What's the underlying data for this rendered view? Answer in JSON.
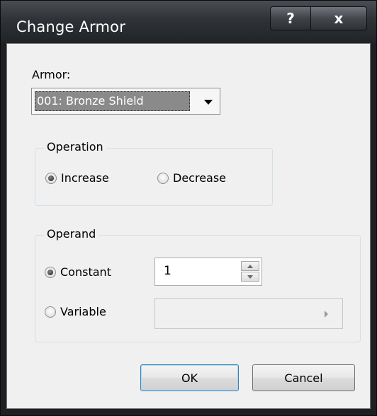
{
  "window": {
    "title": "Change Armor",
    "help_glyph": "?",
    "close_glyph": "x"
  },
  "armor": {
    "label": "Armor:",
    "selected_value": "001: Bronze Shield"
  },
  "operation": {
    "legend": "Operation",
    "options": [
      {
        "label": "Increase",
        "checked": true
      },
      {
        "label": "Decrease",
        "checked": false
      }
    ]
  },
  "operand": {
    "legend": "Operand",
    "constant_label": "Constant",
    "constant_checked": true,
    "constant_value": "1",
    "variable_label": "Variable",
    "variable_checked": false,
    "variable_value": ""
  },
  "buttons": {
    "ok_label": "OK",
    "cancel_label": "Cancel"
  },
  "colors": {
    "titlebar": "#2f3236",
    "client_bg": "#f0f0f0",
    "selected_bg": "#8a8a8a"
  },
  "icons": {
    "help": "question-mark-icon",
    "close": "close-icon",
    "combo_arrow": "chevron-down-icon",
    "spin_up": "arrow-up-icon",
    "spin_down": "arrow-down-icon",
    "variable_arrow": "arrow-right-icon"
  }
}
